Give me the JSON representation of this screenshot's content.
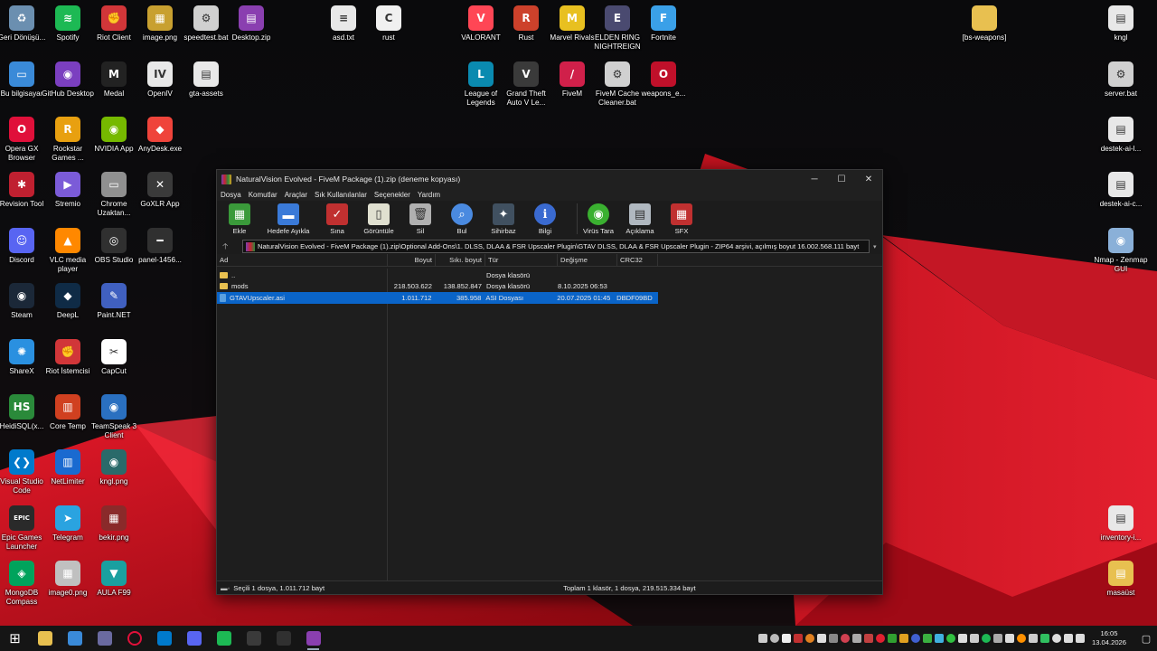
{
  "desktop": {
    "icons": [
      {
        "label": "Geri Dönüşü...",
        "icon": "recycle-bin-icon",
        "color": "#6b8fb0",
        "glyph": "♻"
      },
      {
        "label": "Spotify",
        "icon": "spotify-icon",
        "color": "#1db954",
        "glyph": "≋"
      },
      {
        "label": "Riot Client",
        "icon": "riot-client-icon",
        "color": "#d13639",
        "glyph": "✊"
      },
      {
        "label": "image.png",
        "icon": "image-file-icon",
        "color": "#c8a030",
        "glyph": "▦"
      },
      {
        "label": "speedtest.bat",
        "icon": "batch-file-icon",
        "color": "#d0d0d0",
        "glyph": "⚙"
      },
      {
        "label": "Desktop.zip",
        "icon": "winrar-archive-icon",
        "color": "#8a3fb0",
        "glyph": "▤"
      },
      {
        "label": "asd.txt",
        "icon": "text-file-icon",
        "color": "#e8e8e8",
        "glyph": "≡"
      },
      {
        "label": "rust",
        "icon": "rust-file-icon",
        "color": "#f0f0f0",
        "glyph": "C"
      },
      {
        "label": "VALORANT",
        "icon": "valorant-icon",
        "color": "#ff4655",
        "glyph": "V"
      },
      {
        "label": "Rust",
        "icon": "rust-game-icon",
        "color": "#cd412b",
        "glyph": "R"
      },
      {
        "label": "Marvel Rivals",
        "icon": "marvel-rivals-icon",
        "color": "#e8c020",
        "glyph": "M"
      },
      {
        "label": "ELDEN RING NIGHTREIGN",
        "icon": "elden-ring-icon",
        "color": "#4a4a70",
        "glyph": "E"
      },
      {
        "label": "Fortnite",
        "icon": "fortnite-icon",
        "color": "#3aa0e8",
        "glyph": "F"
      },
      {
        "label": "[bs-weapons]",
        "icon": "folder-icon",
        "color": "#e8c050",
        "glyph": ""
      },
      {
        "label": "kngl",
        "icon": "file-icon",
        "color": "#e8e8e8",
        "glyph": "▤"
      },
      {
        "label": "Bu bilgisayar",
        "icon": "this-pc-icon",
        "color": "#3a8ad8",
        "glyph": "▭"
      },
      {
        "label": "GitHub Desktop",
        "icon": "github-desktop-icon",
        "color": "#7b3fc0",
        "glyph": "◉"
      },
      {
        "label": "Medal",
        "icon": "medal-icon",
        "color": "#222222",
        "glyph": "M"
      },
      {
        "label": "OpenIV",
        "icon": "openiv-icon",
        "color": "#e8e8e8",
        "glyph": "IV"
      },
      {
        "label": "gta-assets",
        "icon": "file-icon",
        "color": "#e8e8e8",
        "glyph": "▤"
      },
      {
        "label": "League of Legends",
        "icon": "league-icon",
        "color": "#0a8ab0",
        "glyph": "L"
      },
      {
        "label": "Grand Theft Auto V Le...",
        "icon": "gta-v-icon",
        "color": "#3a3a3a",
        "glyph": "V"
      },
      {
        "label": "FiveM",
        "icon": "fivem-icon",
        "color": "#d0204a",
        "glyph": "/"
      },
      {
        "label": "FiveM Cache Cleaner.bat",
        "icon": "batch-file-icon",
        "color": "#d0d0d0",
        "glyph": "⚙"
      },
      {
        "label": "weapons_e...",
        "icon": "opera-icon",
        "color": "#c0102a",
        "glyph": "O"
      },
      {
        "label": "server.bat",
        "icon": "batch-file-icon",
        "color": "#d0d0d0",
        "glyph": "⚙"
      },
      {
        "label": "Opera GX Browser",
        "icon": "opera-gx-icon",
        "color": "#e0103a",
        "glyph": "O"
      },
      {
        "label": "Rockstar Games ...",
        "icon": "rockstar-icon",
        "color": "#e8a010",
        "glyph": "R"
      },
      {
        "label": "NVIDIA App",
        "icon": "nvidia-icon",
        "color": "#76b900",
        "glyph": "◉"
      },
      {
        "label": "AnyDesk.exe",
        "icon": "anydesk-icon",
        "color": "#ef443b",
        "glyph": "◆"
      },
      {
        "label": "destek-ai-l...",
        "icon": "file-icon",
        "color": "#e8e8e8",
        "glyph": "▤"
      },
      {
        "label": "Revision Tool",
        "icon": "revision-tool-icon",
        "color": "#c02030",
        "glyph": "✱"
      },
      {
        "label": "Stremio",
        "icon": "stremio-icon",
        "color": "#7b5bd8",
        "glyph": "▶"
      },
      {
        "label": "Chrome Uzaktan...",
        "icon": "chrome-remote-icon",
        "color": "#909090",
        "glyph": "▭"
      },
      {
        "label": "GoXLR App",
        "icon": "goxlr-icon",
        "color": "#3a3a3a",
        "glyph": "✕"
      },
      {
        "label": "destek-ai-c...",
        "icon": "file-icon",
        "color": "#e8e8e8",
        "glyph": "▤"
      },
      {
        "label": "Discord",
        "icon": "discord-icon",
        "color": "#5865f2",
        "glyph": "☺"
      },
      {
        "label": "VLC media player",
        "icon": "vlc-icon",
        "color": "#ff8800",
        "glyph": "▲"
      },
      {
        "label": "OBS Studio",
        "icon": "obs-icon",
        "color": "#303030",
        "glyph": "◎"
      },
      {
        "label": "panel-1456...",
        "icon": "file-icon",
        "color": "#303030",
        "glyph": "━"
      },
      {
        "label": "Nmap - Zenmap GUI",
        "icon": "nmap-icon",
        "color": "#8ab0d8",
        "glyph": "◉"
      },
      {
        "label": "Steam",
        "icon": "steam-icon",
        "color": "#1b2838",
        "glyph": "◉"
      },
      {
        "label": "DeepL",
        "icon": "deepl-icon",
        "color": "#0f2b46",
        "glyph": "◆"
      },
      {
        "label": "Paint.NET",
        "icon": "paint-net-icon",
        "color": "#4060c0",
        "glyph": "✎"
      },
      {
        "label": "ShareX",
        "icon": "sharex-icon",
        "color": "#2a90e0",
        "glyph": "✺"
      },
      {
        "label": "Riot İstemcisi",
        "icon": "riot-client-icon",
        "color": "#d13639",
        "glyph": "✊"
      },
      {
        "label": "CapCut",
        "icon": "capcut-icon",
        "color": "#ffffff",
        "glyph": "✂"
      },
      {
        "label": "HeidiSQL(x...",
        "icon": "heidisql-icon",
        "color": "#2a8a3a",
        "glyph": "HS"
      },
      {
        "label": "Core Temp",
        "icon": "core-temp-icon",
        "color": "#d04020",
        "glyph": "▥"
      },
      {
        "label": "TeamSpeak 3 Client",
        "icon": "teamspeak-icon",
        "color": "#2a70c0",
        "glyph": "◉"
      },
      {
        "label": "Visual Studio Code",
        "icon": "vscode-icon",
        "color": "#007acc",
        "glyph": "❮❯"
      },
      {
        "label": "NetLimiter",
        "icon": "netlimiter-icon",
        "color": "#1a6ad0",
        "glyph": "▥"
      },
      {
        "label": "kngl.png",
        "icon": "image-file-icon",
        "color": "#2a6a6a",
        "glyph": "◉"
      },
      {
        "label": "Epic Games Launcher",
        "icon": "epic-games-icon",
        "color": "#2a2a2a",
        "glyph": "EPIC"
      },
      {
        "label": "Telegram",
        "icon": "telegram-icon",
        "color": "#2aa3e0",
        "glyph": "➤"
      },
      {
        "label": "bekir.png",
        "icon": "image-file-icon",
        "color": "#8a2a2a",
        "glyph": "▦"
      },
      {
        "label": "inventory-i...",
        "icon": "file-icon",
        "color": "#e8e8e8",
        "glyph": "▤"
      },
      {
        "label": "MongoDB Compass",
        "icon": "mongodb-icon",
        "color": "#00a35c",
        "glyph": "◈"
      },
      {
        "label": "image0.png",
        "icon": "image-file-icon",
        "color": "#c0c0c0",
        "glyph": "▦"
      },
      {
        "label": "AULA F99",
        "icon": "aula-icon",
        "color": "#1aa0a0",
        "glyph": "▼"
      },
      {
        "label": "masaüst",
        "icon": "file-icon",
        "color": "#e8c050",
        "glyph": "▤"
      }
    ]
  },
  "window": {
    "title": "NaturalVision Evolved - FiveM Package (1).zip (deneme kopyası)",
    "menu": [
      "Dosya",
      "Komutlar",
      "Araçlar",
      "Sık Kullanılanlar",
      "Seçenekler",
      "Yardım"
    ],
    "toolbar": [
      {
        "label": "Ekle",
        "icon": "add-icon",
        "color": "#3a9a3a",
        "glyph": "▦"
      },
      {
        "label": "Hedefe Ayıkla",
        "icon": "extract-icon",
        "color": "#3a7ad8",
        "glyph": "▬"
      },
      {
        "label": "Sına",
        "icon": "test-icon",
        "color": "#c03030",
        "glyph": "✓"
      },
      {
        "label": "Görüntüle",
        "icon": "view-icon",
        "color": "#e0e0d0",
        "glyph": "▯"
      },
      {
        "label": "Sil",
        "icon": "delete-icon",
        "color": "#b0b0b0",
        "glyph": "🗑"
      },
      {
        "label": "Bul",
        "icon": "find-icon",
        "color": "#4a8ae0",
        "glyph": "⌕"
      },
      {
        "label": "Sihirbaz",
        "icon": "wizard-icon",
        "color": "#405060",
        "glyph": "✦"
      },
      {
        "label": "Bilgi",
        "icon": "info-icon",
        "color": "#3a6ad0",
        "glyph": "ℹ"
      },
      {
        "label": "Virüs Tara",
        "icon": "virus-scan-icon",
        "color": "#3ab030",
        "glyph": "◉"
      },
      {
        "label": "Açıklama",
        "icon": "comment-icon",
        "color": "#b0b8c0",
        "glyph": "▤"
      },
      {
        "label": "SFX",
        "icon": "sfx-icon",
        "color": "#c03030",
        "glyph": "▦"
      }
    ],
    "path": "NaturalVision Evolved - FiveM Package (1).zip\\Optional Add-Ons\\1. DLSS, DLAA & FSR Upscaler Plugin\\GTAV DLSS, DLAA & FSR Upscaler Plugin - ZIP64 arşivi, açılmış boyut 16.002.568.111 bayt",
    "columns": [
      "Ad",
      "Boyut",
      "Sıkı. boyut",
      "Tür",
      "Değişme",
      "CRC32"
    ],
    "rows": [
      {
        "name": "..",
        "size": "",
        "packed": "",
        "type": "Dosya klasörü",
        "modified": "",
        "crc": "",
        "kind": "folder",
        "selected": false
      },
      {
        "name": "mods",
        "size": "218.503.622",
        "packed": "138.852.847",
        "type": "Dosya klasörü",
        "modified": "8.10.2025 06:53",
        "crc": "",
        "kind": "folder",
        "selected": false
      },
      {
        "name": "GTAVUpscaler.asi",
        "size": "1.011.712",
        "packed": "385.958",
        "type": "ASI Dosyası",
        "modified": "20.07.2025 01:45",
        "crc": "DBDF09BD",
        "kind": "file",
        "selected": true
      }
    ],
    "status_left": "Seçili 1 dosya, 1.011.712 bayt",
    "status_right": "Toplam 1 klasör, 1 dosya, 219.515.334 bayt"
  },
  "taskbar": {
    "apps": [
      {
        "icon": "start-icon",
        "color": "#ffffff"
      },
      {
        "icon": "file-explorer-icon",
        "color": "#e8c050"
      },
      {
        "icon": "this-pc-icon",
        "color": "#3a8ad8"
      },
      {
        "icon": "revision-tool-icon",
        "color": "#6a6aa0"
      },
      {
        "icon": "opera-gx-icon",
        "color": "#e0103a"
      },
      {
        "icon": "vscode-icon",
        "color": "#007acc"
      },
      {
        "icon": "discord-icon",
        "color": "#5865f2"
      },
      {
        "icon": "spotify-icon",
        "color": "#1db954"
      },
      {
        "icon": "goxlr-icon",
        "color": "#3a3a3a"
      },
      {
        "icon": "obs-icon",
        "color": "#303030"
      },
      {
        "icon": "winrar-icon",
        "color": "#8a3fb0"
      }
    ],
    "time": "16:05",
    "date": "13.04.2026"
  }
}
